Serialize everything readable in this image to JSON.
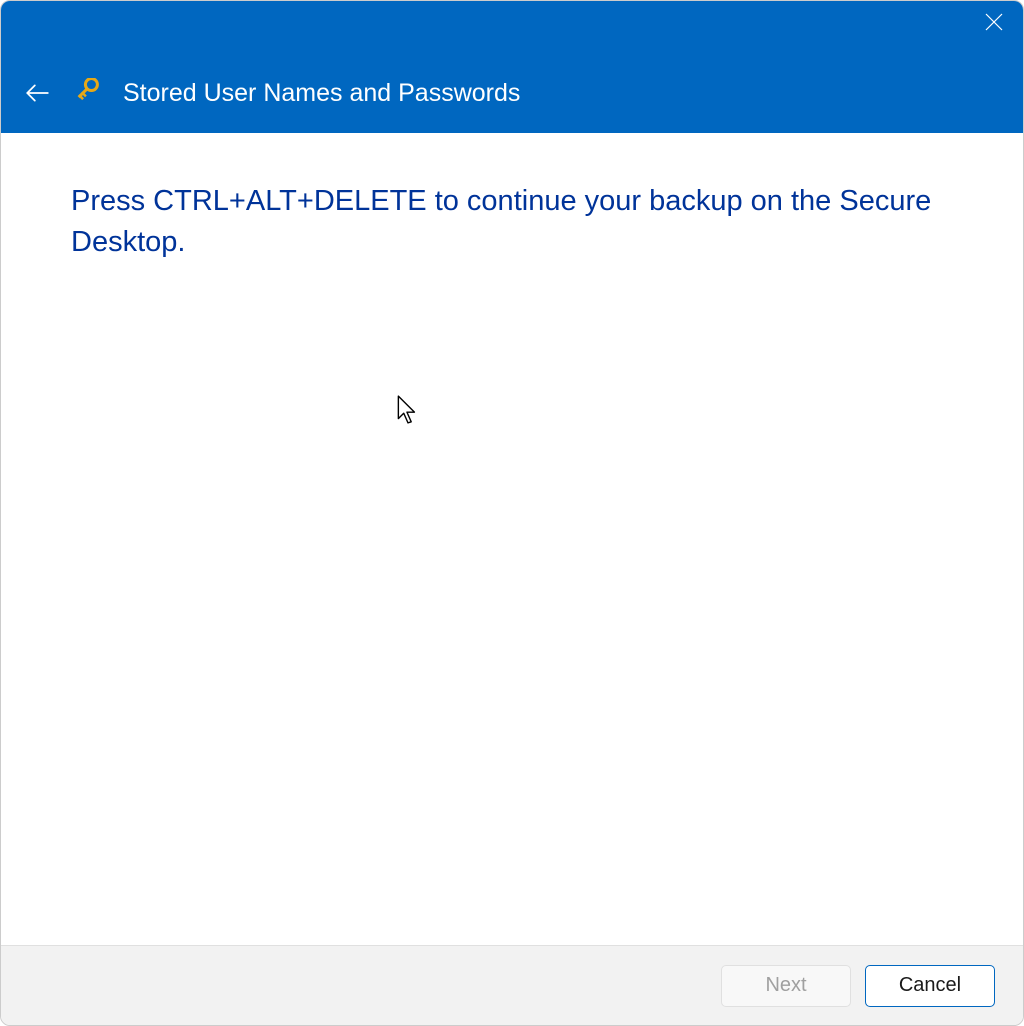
{
  "header": {
    "title": "Stored User Names and Passwords"
  },
  "content": {
    "instruction": "Press CTRL+ALT+DELETE to continue your backup on the Secure Desktop."
  },
  "footer": {
    "next_label": "Next",
    "cancel_label": "Cancel"
  }
}
